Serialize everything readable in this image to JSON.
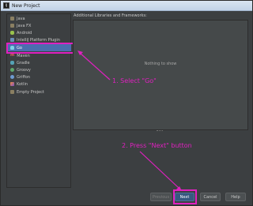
{
  "window": {
    "title": "New Project",
    "icon_name": "intellij-app-icon"
  },
  "sidebar": {
    "items": [
      {
        "label": "Java",
        "icon": "folder-icon",
        "selected": false
      },
      {
        "label": "Java FX",
        "icon": "folder-icon",
        "selected": false
      },
      {
        "label": "Android",
        "icon": "android-icon",
        "selected": false
      },
      {
        "label": "IntelliJ Platform Plugin",
        "icon": "plugin-icon",
        "selected": false
      },
      {
        "label": "Go",
        "icon": "go-gopher-icon",
        "selected": true
      },
      {
        "label": "Maven",
        "icon": "maven-icon",
        "selected": false
      },
      {
        "label": "Gradle",
        "icon": "gradle-icon",
        "selected": false
      },
      {
        "label": "Groovy",
        "icon": "groovy-icon",
        "selected": false
      },
      {
        "label": "Griffon",
        "icon": "griffon-icon",
        "selected": false
      },
      {
        "label": "Kotlin",
        "icon": "kotlin-icon",
        "selected": false
      },
      {
        "label": "Empty Project",
        "icon": "folder-icon",
        "selected": false
      }
    ]
  },
  "main": {
    "section_title": "Additional Libraries and Frameworks:",
    "empty_message": "Nothing to show"
  },
  "annotations": {
    "step1": "1. Select \"Go\"",
    "step2": "2. Press \"Next\" button",
    "color": "#e020c0"
  },
  "buttons": {
    "previous": "Previous",
    "next": "Next",
    "cancel": "Cancel",
    "help": "Help"
  },
  "colors": {
    "background": "#3c3f41",
    "selection": "#4b6eaf",
    "default_button": "#365880"
  }
}
